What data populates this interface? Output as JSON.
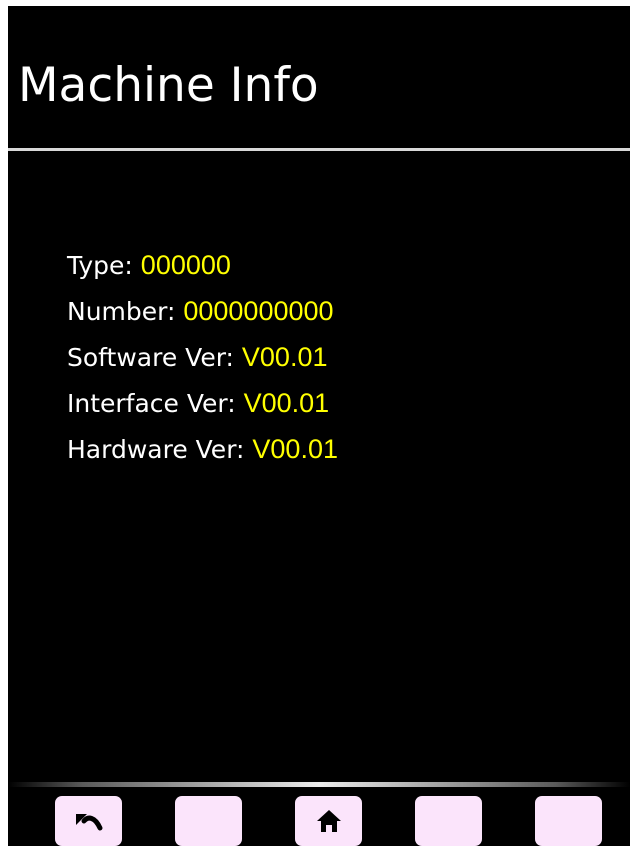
{
  "header": {
    "title": "Machine Info"
  },
  "info": [
    {
      "label": "Type: ",
      "value": "000000"
    },
    {
      "label": "Number: ",
      "value": "0000000000"
    },
    {
      "label": "Software Ver:  ",
      "value": "V00.01"
    },
    {
      "label": "Interface Ver:  ",
      "value": "V00.01"
    },
    {
      "label": "Hardware Ver:  ",
      "value": "V00.01"
    }
  ],
  "bottom_bar": {
    "buttons": [
      {
        "name": "back-button",
        "icon": "undo-arrow-icon"
      },
      {
        "name": "softkey-2-button",
        "icon": ""
      },
      {
        "name": "home-button",
        "icon": "home-icon"
      },
      {
        "name": "softkey-4-button",
        "icon": ""
      },
      {
        "name": "softkey-5-button",
        "icon": ""
      }
    ]
  },
  "colors": {
    "background": "#000000",
    "label_text": "#ffffff",
    "value_text": "#ffff00",
    "button_fill": "#fbe4fb",
    "icon": "#000000"
  }
}
